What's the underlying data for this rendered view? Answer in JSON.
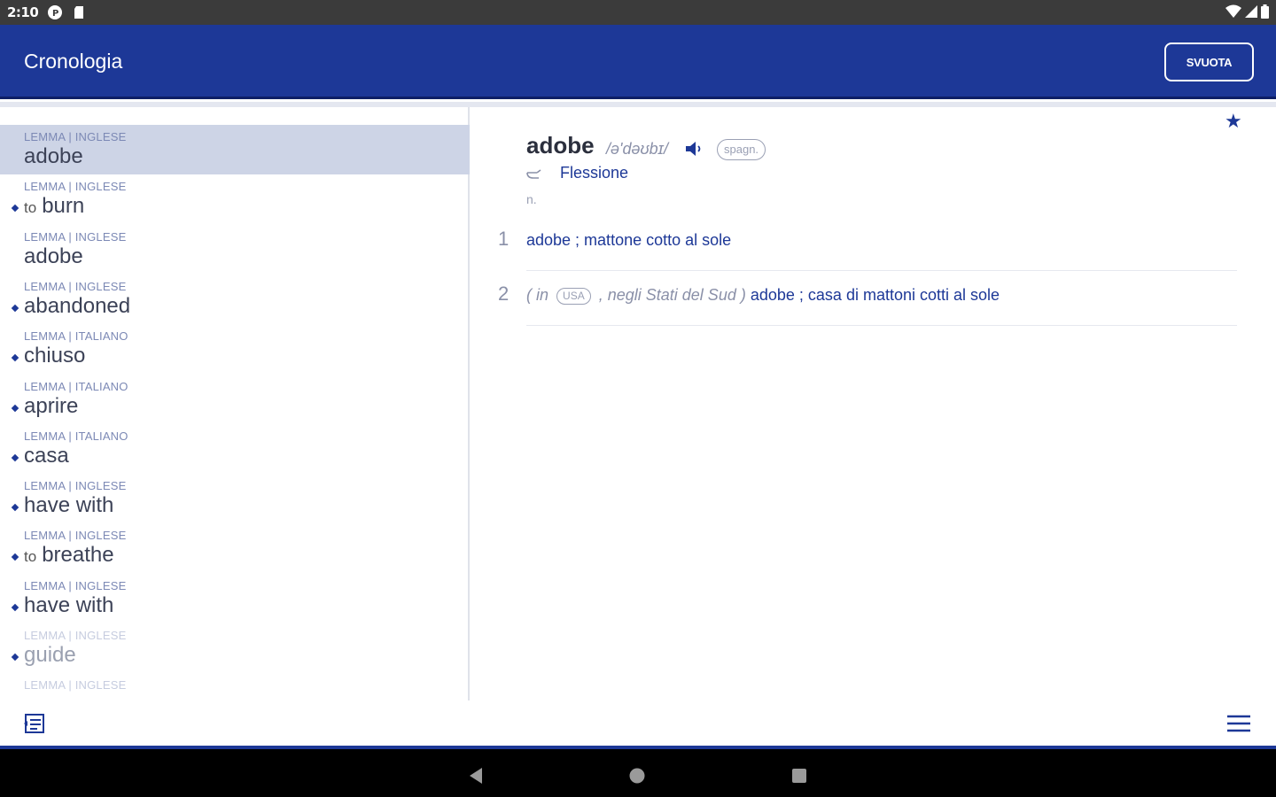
{
  "status_bar": {
    "time": "2:10",
    "icons_left": [
      "p-notification-icon",
      "sd-card-icon"
    ],
    "icons_right": [
      "wifi-icon",
      "signal-icon",
      "battery-icon"
    ]
  },
  "appbar": {
    "title": "Cronologia",
    "clear_button": "SVUOTA"
  },
  "history": [
    {
      "category": "LEMMA | INGLESE",
      "prefix": "",
      "word": "adobe",
      "selected": true,
      "bullet": false
    },
    {
      "category": "LEMMA | INGLESE",
      "prefix": "to",
      "word": "burn",
      "selected": false,
      "bullet": true
    },
    {
      "category": "LEMMA | INGLESE",
      "prefix": "",
      "word": "adobe",
      "selected": false,
      "bullet": false
    },
    {
      "category": "LEMMA | INGLESE",
      "prefix": "",
      "word": "abandoned",
      "selected": false,
      "bullet": true
    },
    {
      "category": "LEMMA | ITALIANO",
      "prefix": "",
      "word": "chiuso",
      "selected": false,
      "bullet": true
    },
    {
      "category": "LEMMA | ITALIANO",
      "prefix": "",
      "word": "aprire",
      "selected": false,
      "bullet": true
    },
    {
      "category": "LEMMA | ITALIANO",
      "prefix": "",
      "word": "casa",
      "selected": false,
      "bullet": true
    },
    {
      "category": "LEMMA | INGLESE",
      "prefix": "",
      "word": "have with",
      "selected": false,
      "bullet": true
    },
    {
      "category": "LEMMA | INGLESE",
      "prefix": "to",
      "word": "breathe",
      "selected": false,
      "bullet": true
    },
    {
      "category": "LEMMA | INGLESE",
      "prefix": "",
      "word": "have with",
      "selected": false,
      "bullet": true
    },
    {
      "category": "LEMMA | INGLESE",
      "prefix": "",
      "word": "guide",
      "selected": false,
      "bullet": true
    },
    {
      "category": "LEMMA | INGLESE",
      "prefix": "",
      "word": "",
      "selected": false,
      "bullet": false
    }
  ],
  "entry": {
    "headword": "adobe",
    "pronunciation": "/ə'dəʊbɪ/",
    "tag": "spagn.",
    "inflection_link": "Flessione",
    "part_of_speech": "n.",
    "senses": [
      {
        "number": "1",
        "note_pre": "",
        "region": "",
        "note_post": "",
        "text": "adobe ; mattone cotto al sole"
      },
      {
        "number": "2",
        "note_pre": "( in",
        "region": "USA",
        "note_post": ", negli Stati del Sud )",
        "text": "adobe ; casa di mattoni cotti al sole"
      }
    ]
  },
  "colors": {
    "primary": "#1d3897",
    "selected_row": "#cdd4e6",
    "status_bar": "#3b3b3b"
  }
}
